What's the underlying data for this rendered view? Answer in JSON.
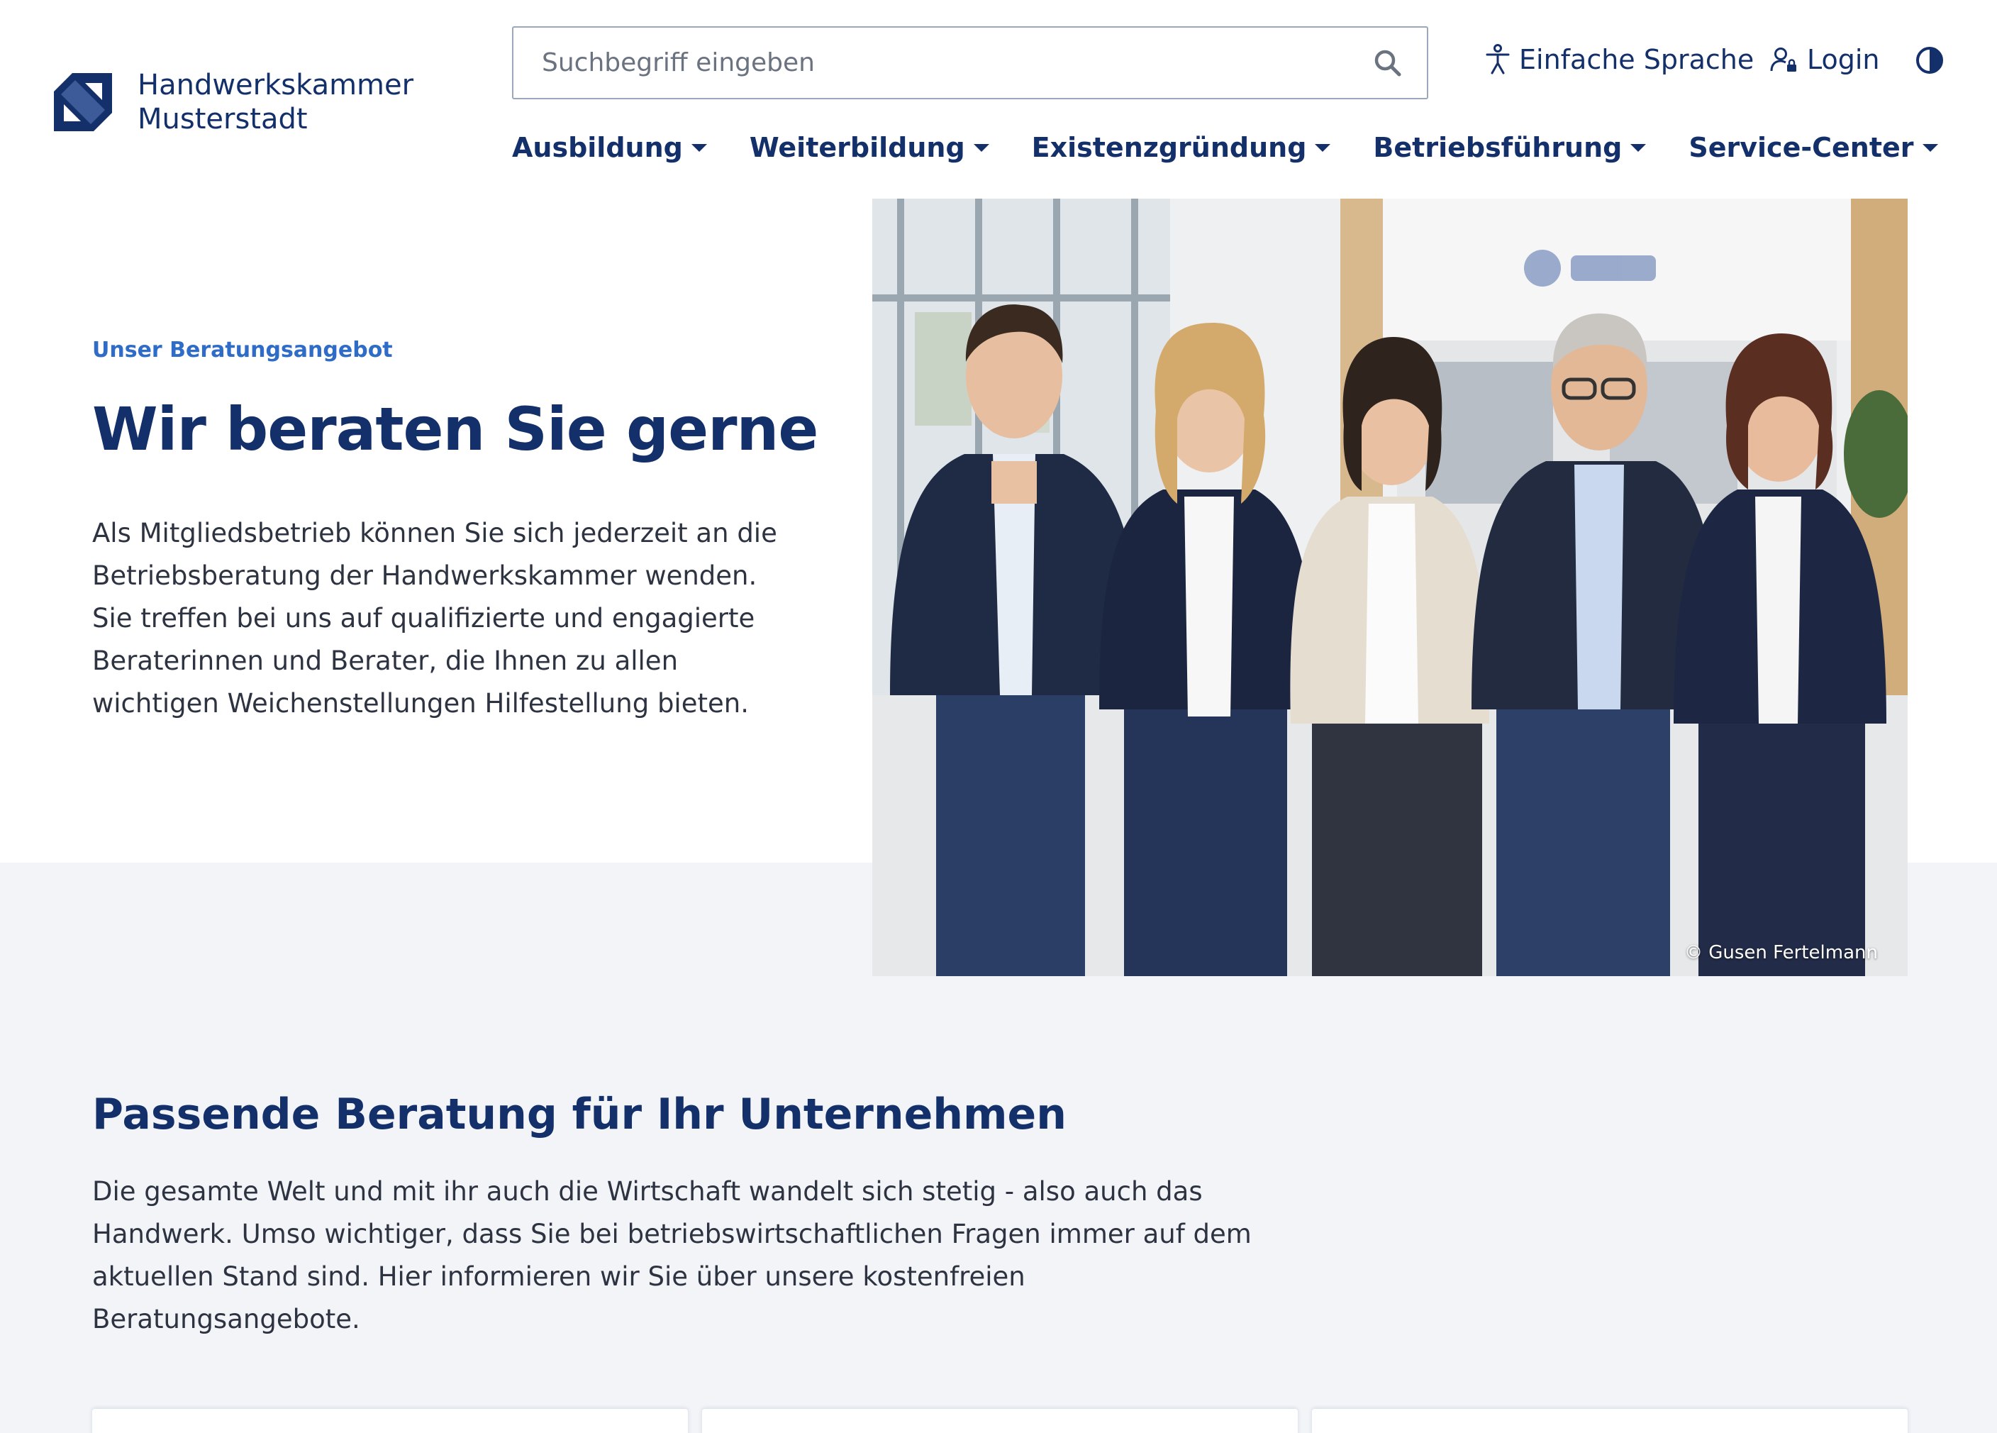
{
  "brand": {
    "line1": "Handwerkskammer",
    "line2": "Musterstadt",
    "color": "#14306b"
  },
  "search": {
    "placeholder": "Suchbegriff eingeben",
    "icon": "search-icon"
  },
  "utility": {
    "easy_language": "Einfache Sprache",
    "login": "Login",
    "contrast_icon": "contrast-icon"
  },
  "nav": {
    "items": [
      {
        "label": "Ausbildung"
      },
      {
        "label": "Weiterbildung"
      },
      {
        "label": "Existenzgründung"
      },
      {
        "label": "Betriebsführung"
      },
      {
        "label": "Service-Center"
      }
    ]
  },
  "hero": {
    "eyebrow": "Unser Beratungsangebot",
    "title": "Wir beraten Sie gerne",
    "text": "Als Mitgliedsbetrieb können Sie sich jederzeit an die Betriebsberatung der Handwerkskammer wenden. Sie treffen bei uns auf qualifizierte und engagierte Beraterinnen und Berater, die Ihnen zu allen wichtigen Weichenstellungen Hilfestellung bieten.",
    "photo_credit": "© Gusen Fertelmann"
  },
  "section": {
    "title": "Passende Beratung für Ihr Unternehmen",
    "text": "Die gesamte Welt und mit ihr auch die Wirtschaft wandelt sich stetig - also auch das Handwerk. Umso wichtiger, dass Sie bei betriebswirtschaftlichen Fragen immer auf dem aktuellen Stand sind. Hier informieren wir Sie über unsere kostenfreien Beratungsangebote."
  },
  "colors": {
    "primary": "#14306b",
    "accent": "#2f6cc7",
    "band": "#f2f4f8"
  }
}
